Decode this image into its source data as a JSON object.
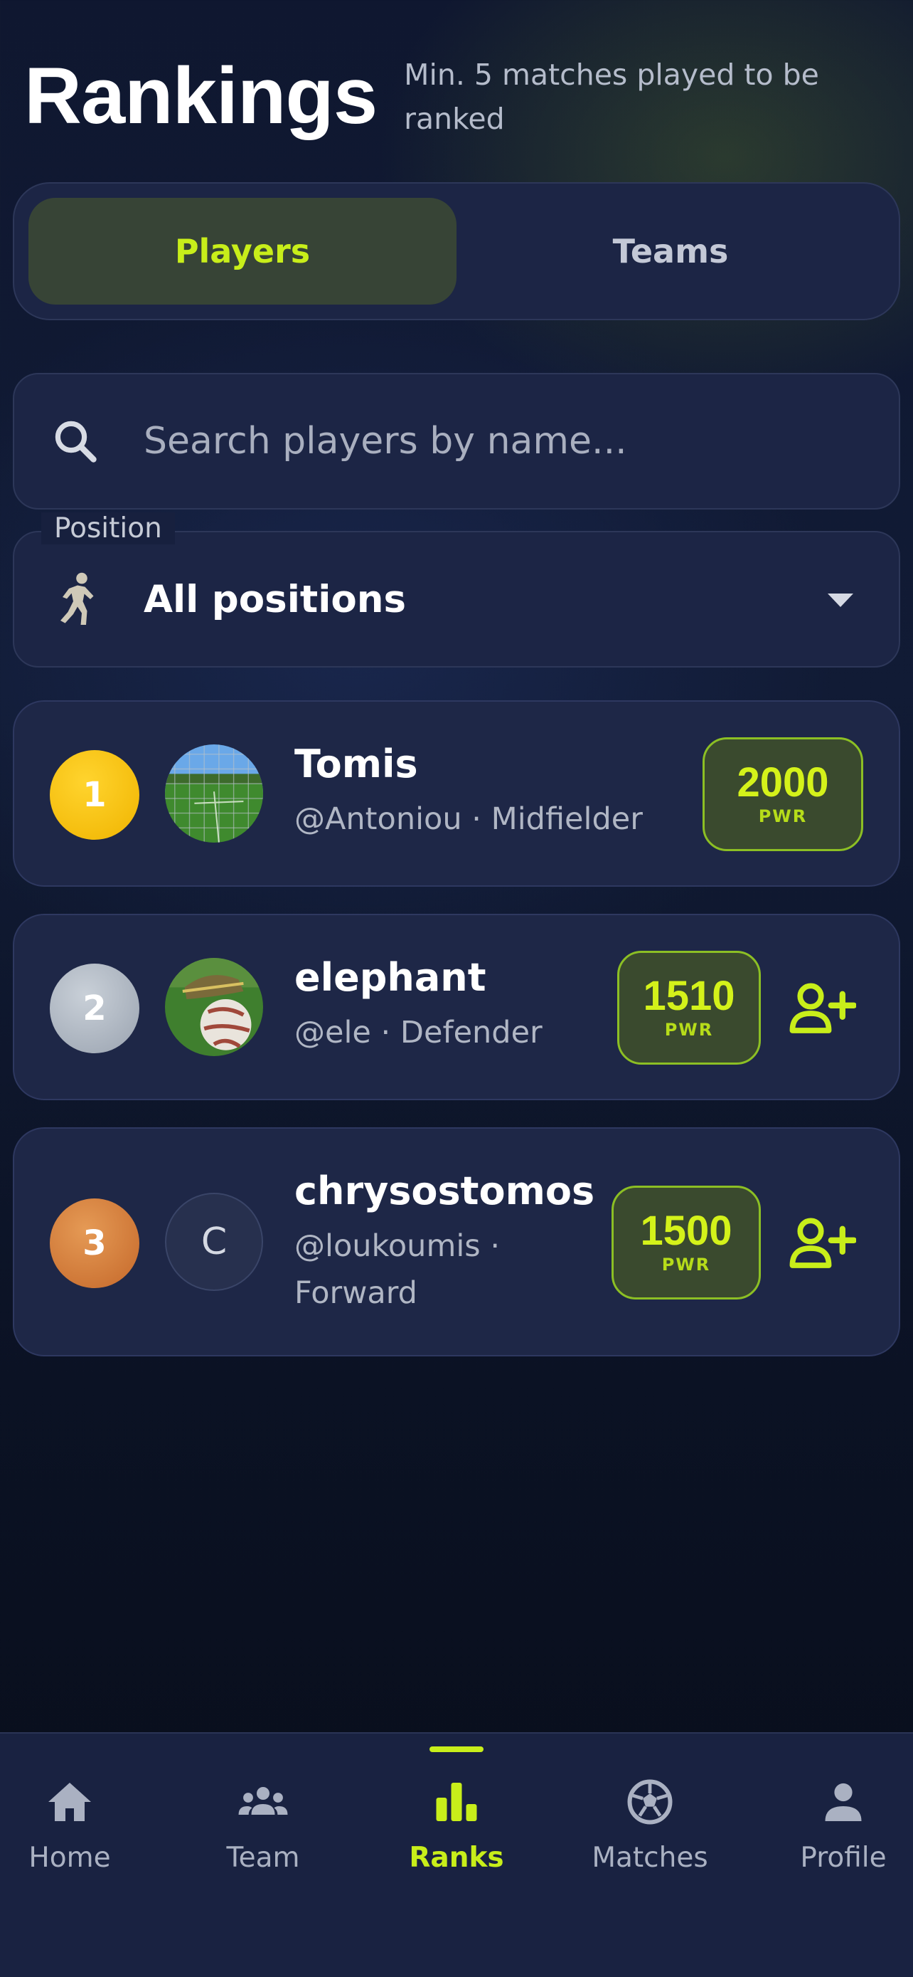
{
  "header": {
    "title": "Rankings",
    "subtitle": "Min. 5 matches played to be ranked"
  },
  "tabs": [
    {
      "label": "Players",
      "active": true
    },
    {
      "label": "Teams",
      "active": false
    }
  ],
  "search": {
    "placeholder": "Search players by name...",
    "icon": "search-icon"
  },
  "position_filter": {
    "label": "Position",
    "value": "All positions",
    "icon": "player-icon"
  },
  "players": [
    {
      "rank": "1",
      "name": "Tomis",
      "username": "@Antoniou",
      "position": "Midfielder",
      "pwr": "2000",
      "pwr_label": "PWR",
      "avatar": "photo-field"
    },
    {
      "rank": "2",
      "name": "elephant",
      "username": "@ele",
      "position": "Defender",
      "pwr": "1510",
      "pwr_label": "PWR",
      "avatar": "photo-ball"
    },
    {
      "rank": "3",
      "name": "chrysostomos",
      "username": "@loukoumis",
      "position": "Forward",
      "pwr": "1500",
      "pwr_label": "PWR",
      "avatar_letter": "C"
    }
  ],
  "nav": [
    {
      "label": "Home",
      "icon": "home-icon"
    },
    {
      "label": "Team",
      "icon": "group-icon"
    },
    {
      "label": "Ranks",
      "icon": "bar-chart-icon",
      "active": true
    },
    {
      "label": "Matches",
      "icon": "soccer-ball-icon"
    },
    {
      "label": "Profile",
      "icon": "person-icon"
    }
  ],
  "colors": {
    "accent": "#c8ee1a",
    "card": "#1e2747",
    "gold": "#f5c400",
    "silver": "#b8c0ca",
    "bronze": "#d47a3a"
  }
}
